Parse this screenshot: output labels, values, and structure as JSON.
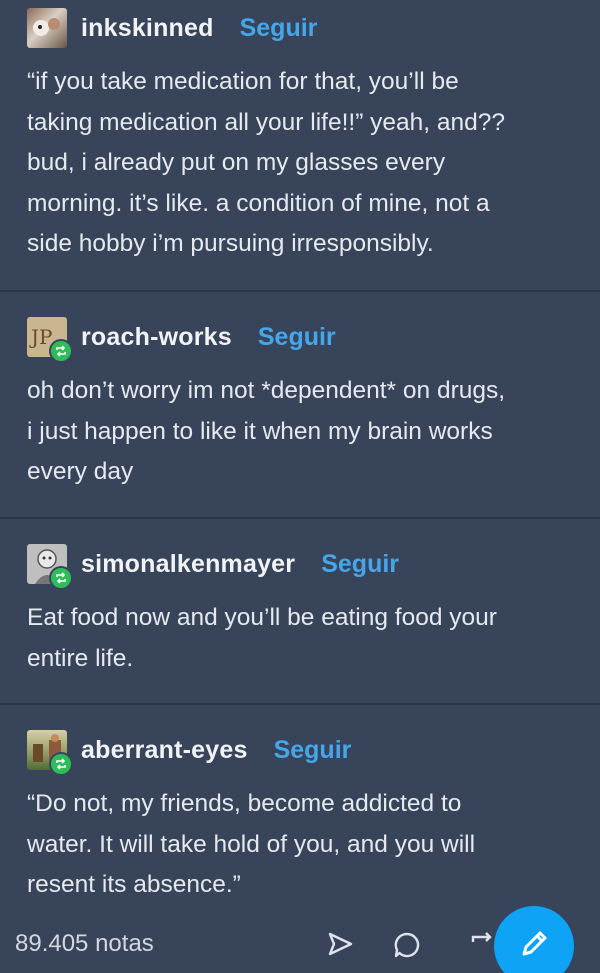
{
  "posts": [
    {
      "username": "inkskinned",
      "follow_label": "Seguir",
      "reblogged": false,
      "body": "“if you take medication for that, you’ll be\ntaking medication all your life!!” yeah, and??\nbud, i already put on my glasses every\nmorning. it’s like. a condition of mine, not a\nside hobby i’m pursuing irresponsibly."
    },
    {
      "username": "roach-works",
      "follow_label": "Seguir",
      "reblogged": true,
      "body": "oh don’t worry im not *dependent* on drugs,\ni just happen to like it when my brain works\nevery day"
    },
    {
      "username": "simonalkenmayer",
      "follow_label": "Seguir",
      "reblogged": true,
      "body": "Eat food now and you’ll be eating food your\nentire life."
    },
    {
      "username": "aberrant-eyes",
      "follow_label": "Seguir",
      "reblogged": true,
      "body": "“Do not, my friends, become addicted to\nwater. It will take hold of you, and you will\nresent its absence.”"
    }
  ],
  "footer": {
    "notes": "89.405 notas"
  },
  "icons": {
    "share": "share-icon",
    "reply": "reply-icon",
    "reblog": "reblog-icon",
    "compose": "pencil-icon"
  },
  "colors": {
    "background": "#37445a",
    "follow": "#46a6ea",
    "reblog_badge": "#2fbd5a",
    "fab": "#0ea3f5"
  }
}
